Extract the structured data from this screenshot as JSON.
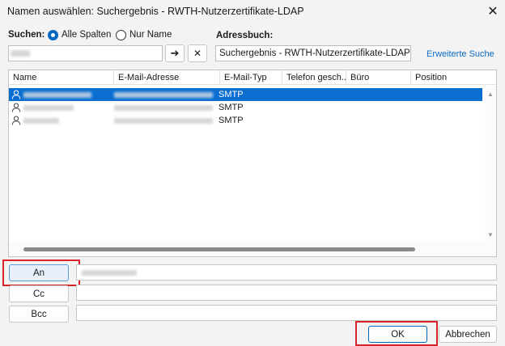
{
  "window": {
    "title": "Namen auswählen: Suchergebnis - RWTH-Nutzerzertifikate-LDAP"
  },
  "search": {
    "label": "Suchen:",
    "radio_all": "Alle Spalten",
    "radio_name": "Nur Name",
    "go_symbol": "➔",
    "clear_symbol": "✕"
  },
  "addressbook": {
    "label": "Adressbuch:",
    "selected": "Suchergebnis - RWTH-Nutzerzertifikate-LDAP",
    "advanced_link": "Erweiterte Suche"
  },
  "list": {
    "columns": [
      "Name",
      "E-Mail-Adresse",
      "E-Mail-Typ",
      "Telefon gesch...",
      "Büro",
      "Position"
    ],
    "rows": [
      {
        "type": "SMTP",
        "selected": true
      },
      {
        "type": "SMTP",
        "selected": false
      },
      {
        "type": "SMTP",
        "selected": false
      }
    ]
  },
  "recipients": {
    "to_label": "An",
    "cc_label": "Cc",
    "bcc_label": "Bcc"
  },
  "buttons": {
    "ok": "OK",
    "cancel": "Abbrechen"
  },
  "colors": {
    "selection": "#0a6ed1",
    "link": "#0b6cc4",
    "highlight": "#d9232b"
  }
}
